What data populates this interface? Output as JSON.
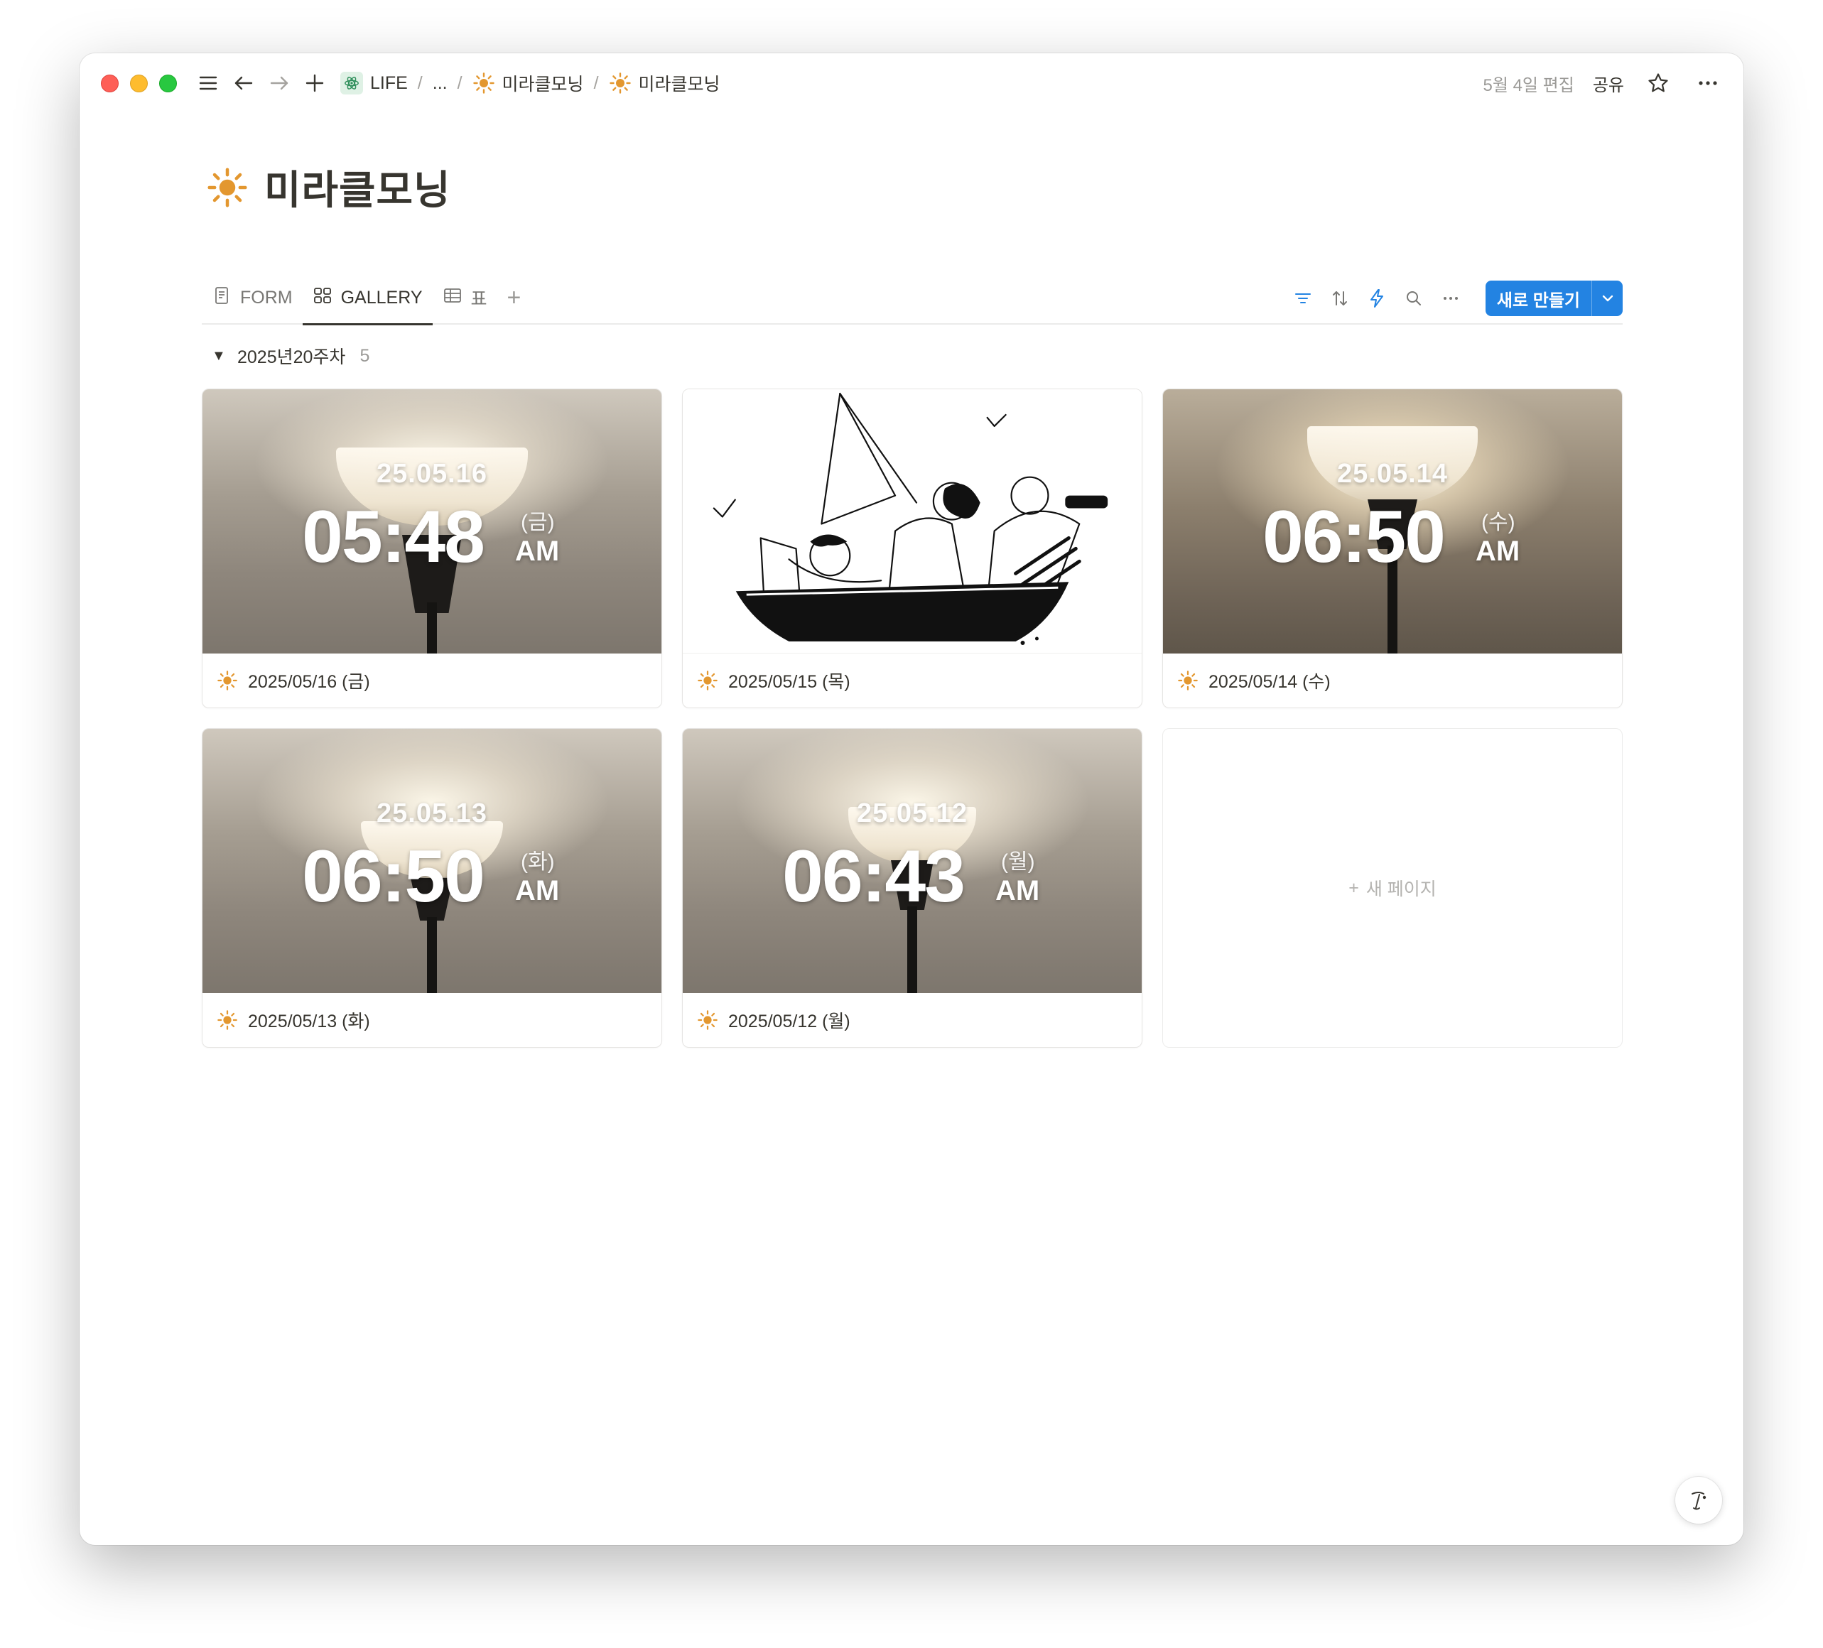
{
  "titlebar": {
    "breadcrumbs": [
      "LIFE",
      "...",
      "미라클모닝",
      "미라클모닝"
    ],
    "edited": "5월 4일 편집",
    "share": "공유"
  },
  "page": {
    "title": "미라클모닝",
    "icon": "sun-icon"
  },
  "views": {
    "tabs": [
      {
        "label": "FORM",
        "icon": "form-icon",
        "active": false
      },
      {
        "label": "GALLERY",
        "icon": "gallery-icon",
        "active": true
      },
      {
        "label": "표",
        "icon": "table-icon",
        "active": false
      }
    ],
    "new_button": "새로 만들기"
  },
  "group": {
    "name": "2025년20주차",
    "count": "5"
  },
  "cards": [
    {
      "title": "2025/05/16 (금)",
      "cover": "photo",
      "overlay_date": "25.05.16",
      "time": "05:48",
      "day": "(금)",
      "ampm": "AM"
    },
    {
      "title": "2025/05/15 (목)",
      "cover": "illustration"
    },
    {
      "title": "2025/05/14 (수)",
      "cover": "photo",
      "overlay_date": "25.05.14",
      "time": "06:50",
      "day": "(수)",
      "ampm": "AM"
    },
    {
      "title": "2025/05/13 (화)",
      "cover": "photo",
      "overlay_date": "25.05.13",
      "time": "06:50",
      "day": "(화)",
      "ampm": "AM"
    },
    {
      "title": "2025/05/12 (월)",
      "cover": "photo",
      "overlay_date": "25.05.12",
      "time": "06:43",
      "day": "(월)",
      "ampm": "AM"
    }
  ],
  "new_page": "새 페이지",
  "colors": {
    "accent": "#2383e2",
    "sun": "#e3972f",
    "text": "#37352f",
    "muted": "#9b9a97"
  }
}
